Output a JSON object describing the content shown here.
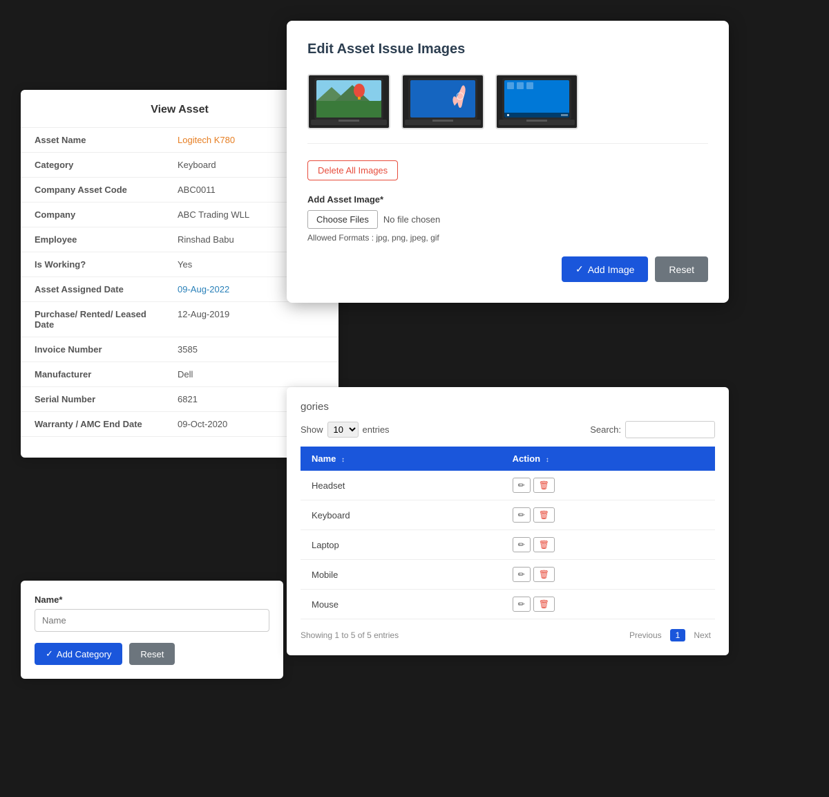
{
  "viewAsset": {
    "title": "View Asset",
    "fields": [
      {
        "label": "Asset Name",
        "value": "Logitech K780",
        "style": "highlight"
      },
      {
        "label": "Category",
        "value": "Keyboard",
        "style": "normal"
      },
      {
        "label": "Company Asset Code",
        "value": "ABC0011",
        "style": "normal"
      },
      {
        "label": "Company",
        "value": "ABC Trading WLL",
        "style": "normal"
      },
      {
        "label": "Employee",
        "value": "Rinshad Babu",
        "style": "normal"
      },
      {
        "label": "Is Working?",
        "value": "Yes",
        "style": "normal"
      },
      {
        "label": "Asset Assigned Date",
        "value": "09-Aug-2022",
        "style": "blue"
      },
      {
        "label": "Purchase/ Rented/ Leased Date",
        "value": "12-Aug-2019",
        "style": "normal"
      },
      {
        "label": "Invoice Number",
        "value": "3585",
        "style": "normal"
      },
      {
        "label": "Manufacturer",
        "value": "Dell",
        "style": "normal"
      },
      {
        "label": "Serial Number",
        "value": "6821",
        "style": "normal"
      },
      {
        "label": "Warranty / AMC End Date",
        "value": "09-Oct-2020",
        "style": "normal"
      }
    ]
  },
  "addCategory": {
    "label": "Name*",
    "placeholder": "Name",
    "addBtn": "Add Category",
    "resetBtn": "Reset"
  },
  "editImages": {
    "title": "Edit Asset Issue Images",
    "deleteAllBtn": "Delete All Images",
    "addImageLabel": "Add Asset Image*",
    "chooseFilesBtn": "Choose Files",
    "noFileText": "No file chosen",
    "allowedFormats": "Allowed Formats : jpg, png, jpeg, gif",
    "addImageBtn": "Add Image",
    "resetBtn": "Reset"
  },
  "categories": {
    "headerText": "gories",
    "showLabel": "Show",
    "entriesValue": "10",
    "entriesLabel": "entries",
    "searchLabel": "Search:",
    "columns": [
      "Name",
      "Action"
    ],
    "rows": [
      {
        "name": "Headset"
      },
      {
        "name": "Keyboard"
      },
      {
        "name": "Laptop"
      },
      {
        "name": "Mobile"
      },
      {
        "name": "Mouse"
      }
    ],
    "showingText": "Showing 1 to 5 of 5 entries",
    "prevBtn": "Previous",
    "currentPage": "1",
    "nextBtn": "Next"
  }
}
